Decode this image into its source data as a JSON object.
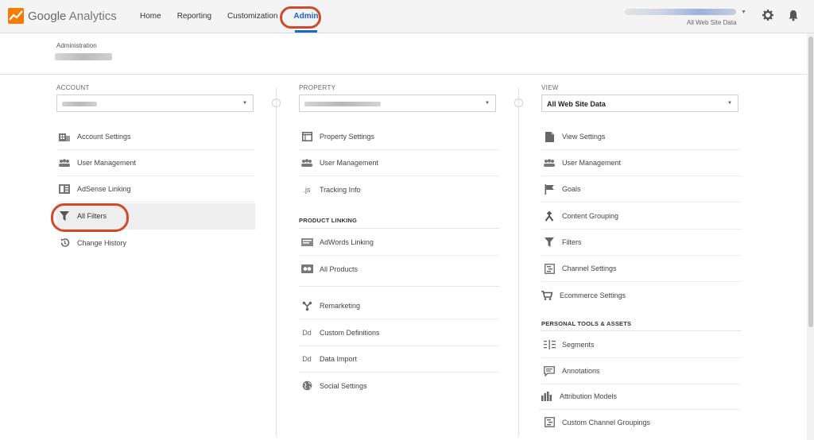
{
  "topbar": {
    "logo_google": "Google",
    "logo_product": "Analytics",
    "nav": [
      {
        "label": "Home"
      },
      {
        "label": "Reporting"
      },
      {
        "label": "Customization"
      },
      {
        "label": "Admin",
        "active": true
      }
    ],
    "account_sub": "All Web Site Data",
    "icons": [
      "gear-icon",
      "bell-icon"
    ],
    "accent_color": "#1a66c9",
    "highlight_color": "#d04a2a"
  },
  "admin": {
    "label": "Administration"
  },
  "account": {
    "title": "ACCOUNT",
    "items": [
      {
        "label": "Account Settings",
        "icon": "building-icon"
      },
      {
        "label": "User Management",
        "icon": "users-icon"
      },
      {
        "label": "AdSense Linking",
        "icon": "adsense-icon"
      },
      {
        "label": "All Filters",
        "icon": "filter-icon",
        "selected": true
      },
      {
        "label": "Change History",
        "icon": "history-icon"
      }
    ]
  },
  "property": {
    "title": "PROPERTY",
    "items": [
      {
        "label": "Property Settings",
        "icon": "window-icon"
      },
      {
        "label": "User Management",
        "icon": "users-icon"
      },
      {
        "label": "Tracking Info",
        "icon": "js-icon",
        "glyph": ".js"
      }
    ],
    "product_linking": {
      "title": "PRODUCT LINKING",
      "items": [
        {
          "label": "AdWords Linking",
          "icon": "adwords-icon"
        },
        {
          "label": "All Products",
          "icon": "products-icon"
        }
      ]
    },
    "more_items": [
      {
        "label": "Remarketing",
        "icon": "remarketing-icon"
      },
      {
        "label": "Custom Definitions",
        "icon": "dd-icon",
        "glyph": "Dd"
      },
      {
        "label": "Data Import",
        "icon": "dd-icon",
        "glyph": "Dd"
      },
      {
        "label": "Social Settings",
        "icon": "globe-icon"
      }
    ]
  },
  "view": {
    "title": "VIEW",
    "selected": "All Web Site Data",
    "items": [
      {
        "label": "View Settings",
        "icon": "document-icon"
      },
      {
        "label": "User Management",
        "icon": "users-icon"
      },
      {
        "label": "Goals",
        "icon": "flag-icon"
      },
      {
        "label": "Content Grouping",
        "icon": "grouping-icon"
      },
      {
        "label": "Filters",
        "icon": "filter-icon"
      },
      {
        "label": "Channel Settings",
        "icon": "channel-icon"
      },
      {
        "label": "Ecommerce Settings",
        "icon": "cart-icon"
      }
    ],
    "personal": {
      "title": "PERSONAL TOOLS & ASSETS",
      "items": [
        {
          "label": "Segments",
          "icon": "segments-icon"
        },
        {
          "label": "Annotations",
          "icon": "annotation-icon"
        },
        {
          "label": "Attribution Models",
          "icon": "attribution-icon"
        },
        {
          "label": "Custom Channel Groupings",
          "icon": "channel-icon"
        }
      ]
    }
  }
}
